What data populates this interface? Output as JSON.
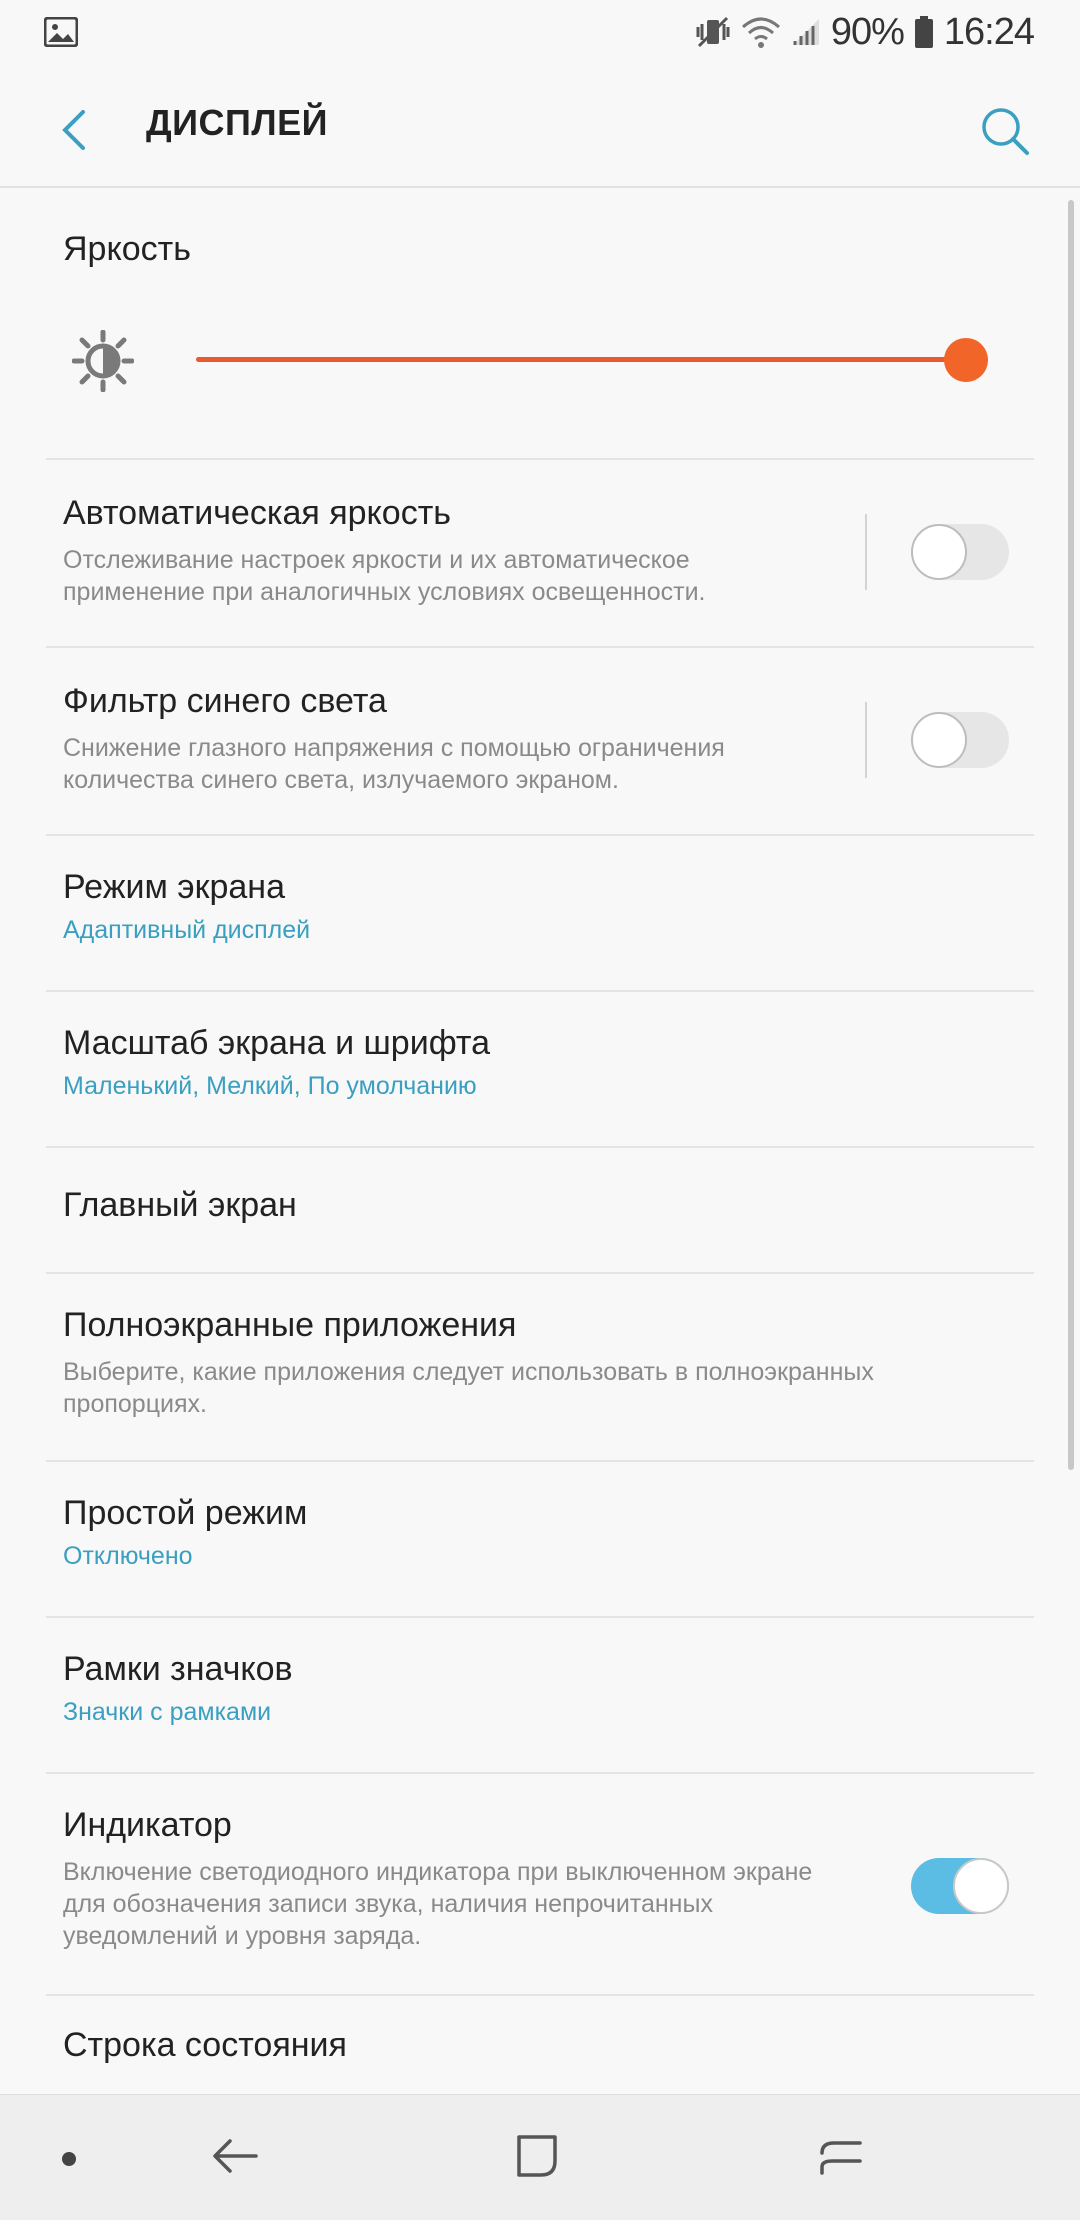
{
  "status_bar": {
    "battery": "90%",
    "time": "16:24",
    "icons": [
      "gallery-icon",
      "vibrate-mute-icon",
      "wifi-icon",
      "signal-icon",
      "battery-icon"
    ]
  },
  "app_bar": {
    "title": "ДИСПЛЕЙ",
    "accent_color": "#3a9fc0"
  },
  "brightness": {
    "title": "Яркость",
    "level": 1.0,
    "track_color": "#e85a2f"
  },
  "settings": [
    {
      "title": "Автоматическая яркость",
      "subtitle": "Отслеживание настроек яркости и их автоматическое применение при аналогичных условиях освещенности.",
      "switch": false
    },
    {
      "title": "Фильтр синего света",
      "subtitle": "Снижение глазного напряжения с помощью ограничения количества синего света, излучаемого экраном.",
      "switch": false
    },
    {
      "title": "Режим экрана",
      "value": "Адаптивный дисплей"
    },
    {
      "title": "Масштаб экрана и шрифта",
      "value": "Маленький, Мелкий, По умолчанию"
    },
    {
      "title": "Главный экран"
    },
    {
      "title": "Полноэкранные приложения",
      "subtitle": "Выберите, какие приложения следует использовать в полноэкранных пропорциях."
    },
    {
      "title": "Простой режим",
      "value": "Отключено"
    },
    {
      "title": "Рамки значков",
      "value": "Значки с рамками"
    },
    {
      "title": "Индикатор",
      "subtitle": "Включение светодиодного индикатора при выключенном экране для обозначения записи звука, наличия непрочитанных уведомлений и уровня заряда.",
      "switch": true
    },
    {
      "title": "Строка состояния"
    }
  ],
  "nav_bar": {
    "icons": [
      "nav-dot-icon",
      "nav-back-icon",
      "nav-home-icon",
      "nav-recent-icon"
    ]
  }
}
